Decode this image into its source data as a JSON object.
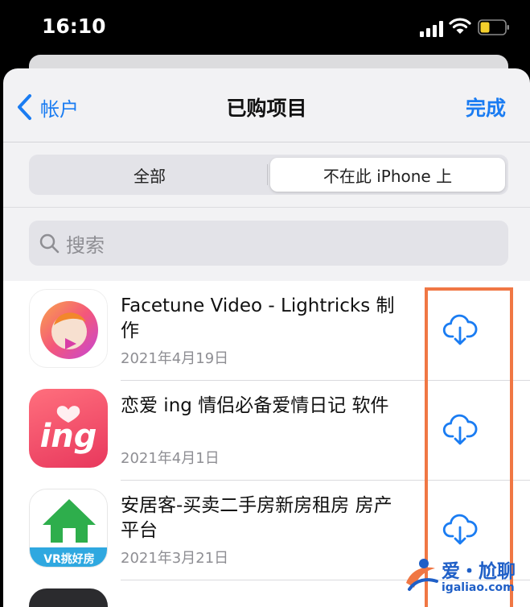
{
  "status_bar": {
    "time": "16:10"
  },
  "nav": {
    "back_label": "帐户",
    "title": "已购项目",
    "done_label": "完成"
  },
  "segments": {
    "all": "全部",
    "not_on_device": "不在此 iPhone 上"
  },
  "search": {
    "placeholder": "搜索"
  },
  "apps": [
    {
      "name": "Facetune Video - Lightricks 制作",
      "date": "2021年4月19日",
      "icon": "facetune-app-icon"
    },
    {
      "name": "恋爱 ing 情侣必备爱情日记 软件",
      "date": "2021年4月1日",
      "icon": "lianai-ing-app-icon",
      "icon_text": "ing"
    },
    {
      "name": "安居客-买卖二手房新房租房 房产平台",
      "date": "2021年3月21日",
      "icon": "anjuke-app-icon",
      "icon_text": "VR挑好房"
    }
  ],
  "watermark": {
    "title": "爱・尬聊",
    "url": "igaliao.com"
  },
  "colors": {
    "accent": "#1a7cf2",
    "highlight": "#f07744",
    "watermark": "#1f5fc7"
  }
}
